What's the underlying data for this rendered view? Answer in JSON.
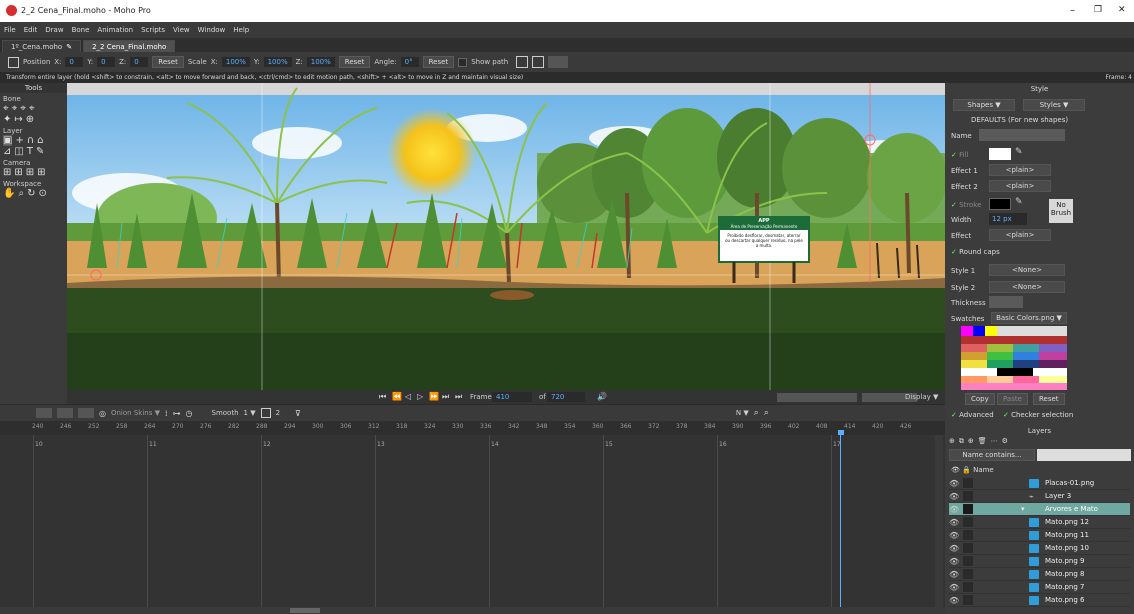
{
  "window": {
    "title": "2_2 Cena_Final.moho - Moho Pro",
    "controls": [
      "–",
      "❐",
      "✕"
    ]
  },
  "menu": [
    "File",
    "Edit",
    "Draw",
    "Bone",
    "Animation",
    "Scripts",
    "View",
    "Window",
    "Help"
  ],
  "tabs": [
    {
      "label": "1º_Cena.moho",
      "active": false
    },
    {
      "label": "2_2 Cena_Final.moho",
      "active": true
    }
  ],
  "toolbar": {
    "position_label": "Position",
    "x_label": "X:",
    "x_value": "0",
    "y_label": "Y:",
    "y_value": "0",
    "z_label": "Z:",
    "z_value": "0",
    "reset1": "Reset",
    "scale_label": "Scale",
    "sx_label": "X:",
    "sx_value": "100%",
    "sy_label": "Y:",
    "sy_value": "100%",
    "sz_label": "Z:",
    "sz_value": "100%",
    "reset2": "Reset",
    "angle_label": "Angle:",
    "angle_value": "0°",
    "reset3": "Reset",
    "show_path": "Show path"
  },
  "status": {
    "text": "Transform entire layer (hold <shift> to constrain, <alt> to move forward and back, <ctrl/cmd> to edit motion path, <shift> + <alt> to move in Z and maintain visual size)",
    "frame": "Frame: 4"
  },
  "tools": {
    "header": "Tools",
    "sections": [
      "Bone",
      "Layer",
      "Camera",
      "Workspace"
    ]
  },
  "sign": {
    "title": "APP",
    "subtitle": "Área de Preservação Permanente",
    "body": "Proibido desflorar, desmatar, aterrar ou descartar qualquer resíduo, na pele a multa."
  },
  "playback": {
    "frame_label": "Frame",
    "frame_value": "410",
    "of_label": "of",
    "of_value": "720",
    "display_label": "Display ▼"
  },
  "timeline": {
    "onion": "Onion Skins ▼",
    "smooth": "Smooth",
    "val1": "1 ▼",
    "val2": "2",
    "ruler": [
      "240",
      "246",
      "252",
      "258",
      "264",
      "270",
      "276",
      "282",
      "288",
      "294",
      "300",
      "306",
      "312",
      "318",
      "324",
      "330",
      "336",
      "342",
      "348",
      "354",
      "360",
      "366",
      "372",
      "378",
      "384",
      "390",
      "396",
      "402",
      "408",
      "414",
      "420",
      "426"
    ],
    "seconds": [
      "10",
      "11",
      "12",
      "13",
      "14",
      "15",
      "16",
      "17"
    ],
    "nav": "N ▼"
  },
  "style_panel": {
    "title": "Style",
    "shapes": "Shapes ▼",
    "styles": "Styles ▼",
    "defaults": "DEFAULTS (For new shapes)",
    "name_label": "Name",
    "fill_label": "Fill",
    "effect1_label": "Effect 1",
    "effect1_value": "<plain>",
    "effect2_label": "Effect 2",
    "effect2_value": "<plain>",
    "stroke_label": "Stroke",
    "no_brush": "No Brush",
    "width_label": "Width",
    "width_value": "12 px",
    "effect_label": "Effect",
    "effect_value": "<plain>",
    "round_caps": "Round caps",
    "style1_label": "Style 1",
    "style1_value": "<None>",
    "style2_label": "Style 2",
    "style2_value": "<None>",
    "thickness_label": "Thickness",
    "swatches_label": "Swatches",
    "swatches_value": "Basic Colors.png ▼",
    "copy": "Copy",
    "paste": "Paste",
    "reset": "Reset",
    "advanced": "Advanced",
    "checker": "Checker selection",
    "colors": {
      "fill": "#ffffff",
      "stroke": "#000000",
      "accent": "#5ab0ff"
    }
  },
  "layers_panel": {
    "title": "Layers",
    "search_placeholder": "Name contains...",
    "name_header": "Name",
    "rows": [
      {
        "name": "Placas-01.png",
        "selected": false
      },
      {
        "name": "Layer 3",
        "selected": false
      },
      {
        "name": "Arvores e Mato",
        "selected": true
      },
      {
        "name": "Mato.png 12",
        "selected": false
      },
      {
        "name": "Mato.png 11",
        "selected": false
      },
      {
        "name": "Mato.png 10",
        "selected": false
      },
      {
        "name": "Mato.png 9",
        "selected": false
      },
      {
        "name": "Mato.png 8",
        "selected": false
      },
      {
        "name": "Mato.png 7",
        "selected": false
      },
      {
        "name": "Mato.png 6",
        "selected": false
      }
    ]
  }
}
